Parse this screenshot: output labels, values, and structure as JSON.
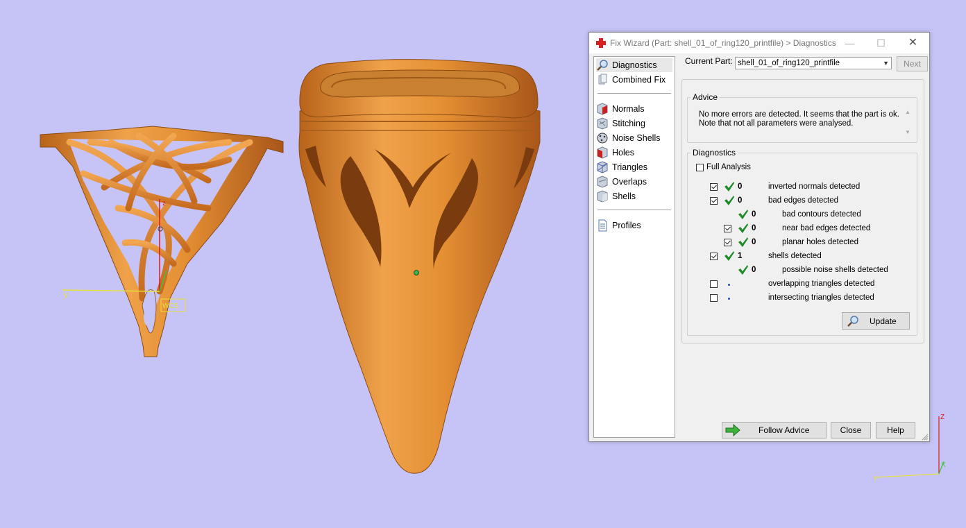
{
  "dialog": {
    "title": "Fix Wizard (Part: shell_01_of_ring120_printfile) > Diagnostics",
    "minimize_glyph": "—",
    "maximize_glyph": "☐",
    "close_glyph": "✕"
  },
  "nav": {
    "items": [
      {
        "label": "Diagnostics",
        "icon": "magnifier-icon",
        "active": true
      },
      {
        "label": "Combined Fix",
        "icon": "combined-fix-icon"
      },
      {
        "label": "Normals",
        "icon": "normals-icon"
      },
      {
        "label": "Stitching",
        "icon": "stitching-icon"
      },
      {
        "label": "Noise Shells",
        "icon": "noise-shells-icon"
      },
      {
        "label": "Holes",
        "icon": "holes-icon"
      },
      {
        "label": "Triangles",
        "icon": "triangles-icon"
      },
      {
        "label": "Overlaps",
        "icon": "overlaps-icon"
      },
      {
        "label": "Shells",
        "icon": "shells-icon"
      },
      {
        "label": "Profiles",
        "icon": "profiles-icon"
      }
    ]
  },
  "current_part": {
    "label": "Current Part:",
    "value": "shell_01_of_ring120_printfile",
    "next_label": "Next"
  },
  "advice": {
    "legend": "Advice",
    "text_line1": "No more errors are detected. It seems that the part is ok.",
    "text_line2": "Note that not all parameters were analysed."
  },
  "diagnostics": {
    "legend": "Diagnostics",
    "full_analysis": {
      "label": "Full Analysis",
      "checked": false
    },
    "rows": [
      {
        "count": "0",
        "label": "inverted normals detected",
        "checked": true
      },
      {
        "count": "0",
        "label": "bad edges detected",
        "checked": true
      },
      {
        "count": "0",
        "label": "bad contours detected"
      },
      {
        "count": "0",
        "label": "near bad edges detected",
        "checked": true
      },
      {
        "count": "0",
        "label": "planar holes detected",
        "checked": true
      },
      {
        "count": "1",
        "label": "shells detected",
        "checked": true
      },
      {
        "count": "0",
        "label": "possible noise shells detected"
      },
      {
        "count": "",
        "label": "overlapping triangles detected",
        "checked": false
      },
      {
        "count": "",
        "label": "intersecting triangles detected",
        "checked": false
      }
    ],
    "update_label": "Update"
  },
  "buttons": {
    "follow_advice": "Follow Advice",
    "close": "Close",
    "help": "Help"
  },
  "viewport": {
    "background": "#c6c4f7",
    "model_color": "#e08a2c",
    "wcs_label": "WCS",
    "left_axes": {
      "y": "y",
      "z": "z",
      "x": "x"
    },
    "corner_axes": {
      "z": "Z",
      "y": "Y",
      "x": "X"
    }
  }
}
